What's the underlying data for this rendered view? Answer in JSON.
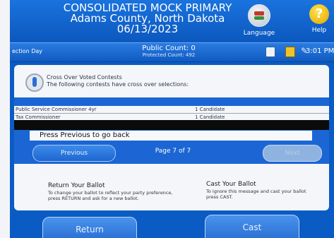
{
  "header": {
    "title_line1": "CONSOLIDATED MOCK PRIMARY",
    "title_line2": "Adams County, North Dakota",
    "title_line3": "06/13/2023",
    "language_label": "Language",
    "help_label": "Help"
  },
  "status": {
    "left_text": "ection Day",
    "public_count": "Public Count: 0",
    "protected_count": "Protected Count: 492",
    "time": "3:01 PM"
  },
  "notice": {
    "title": "Cross Over Voted Contests",
    "text": "The following contests have cross over selections:"
  },
  "contests": [
    {
      "name": "Public Service Commissioner  4yr",
      "selection": "1 Candidate"
    },
    {
      "name": "Tax Commissioner",
      "selection": "1 Candidate"
    }
  ],
  "prev_instruction": "Press Previous to go back",
  "nav": {
    "previous_label": "Previous",
    "page_indicator": "Page 7 of 7",
    "next_label": "Next"
  },
  "return_section": {
    "title": "Return Your Ballot",
    "text": "To change your ballot to reflect your party preference, press RETURN and ask for a new ballot."
  },
  "cast_section": {
    "title": "Cast Your Ballot",
    "text": "To ignore this message and cast your ballot press CAST."
  },
  "buttons": {
    "return_label": "Return",
    "cast_label": "Cast"
  },
  "colors": {
    "screen_blue": "#0a5cc4",
    "panel": "#f4f6f9",
    "help_yellow": "#f0c32a"
  },
  "icons": [
    "language-icon",
    "help-icon",
    "info-icon",
    "document-icon",
    "save-icon",
    "plug-icon"
  ]
}
